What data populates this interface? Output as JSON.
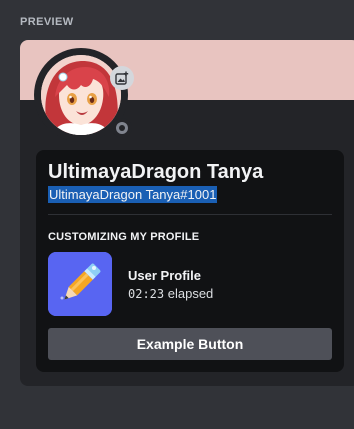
{
  "section": {
    "label": "PREVIEW"
  },
  "profile": {
    "display_name": "UltimayaDragon Tanya",
    "username": "UltimayaDragon Tanya#1001",
    "status": "offline",
    "banner_color": "#e8c4c0"
  },
  "activity": {
    "heading": "CUSTOMIZING MY PROFILE",
    "title": "User Profile",
    "elapsed_time": "02:23",
    "elapsed_suffix": " elapsed",
    "icon": "pencil-icon",
    "icon_bg": "#5865f2"
  },
  "button": {
    "label": "Example Button"
  },
  "icons": {
    "avatar_edit": "add-image-icon",
    "status": "offline-status-icon"
  }
}
